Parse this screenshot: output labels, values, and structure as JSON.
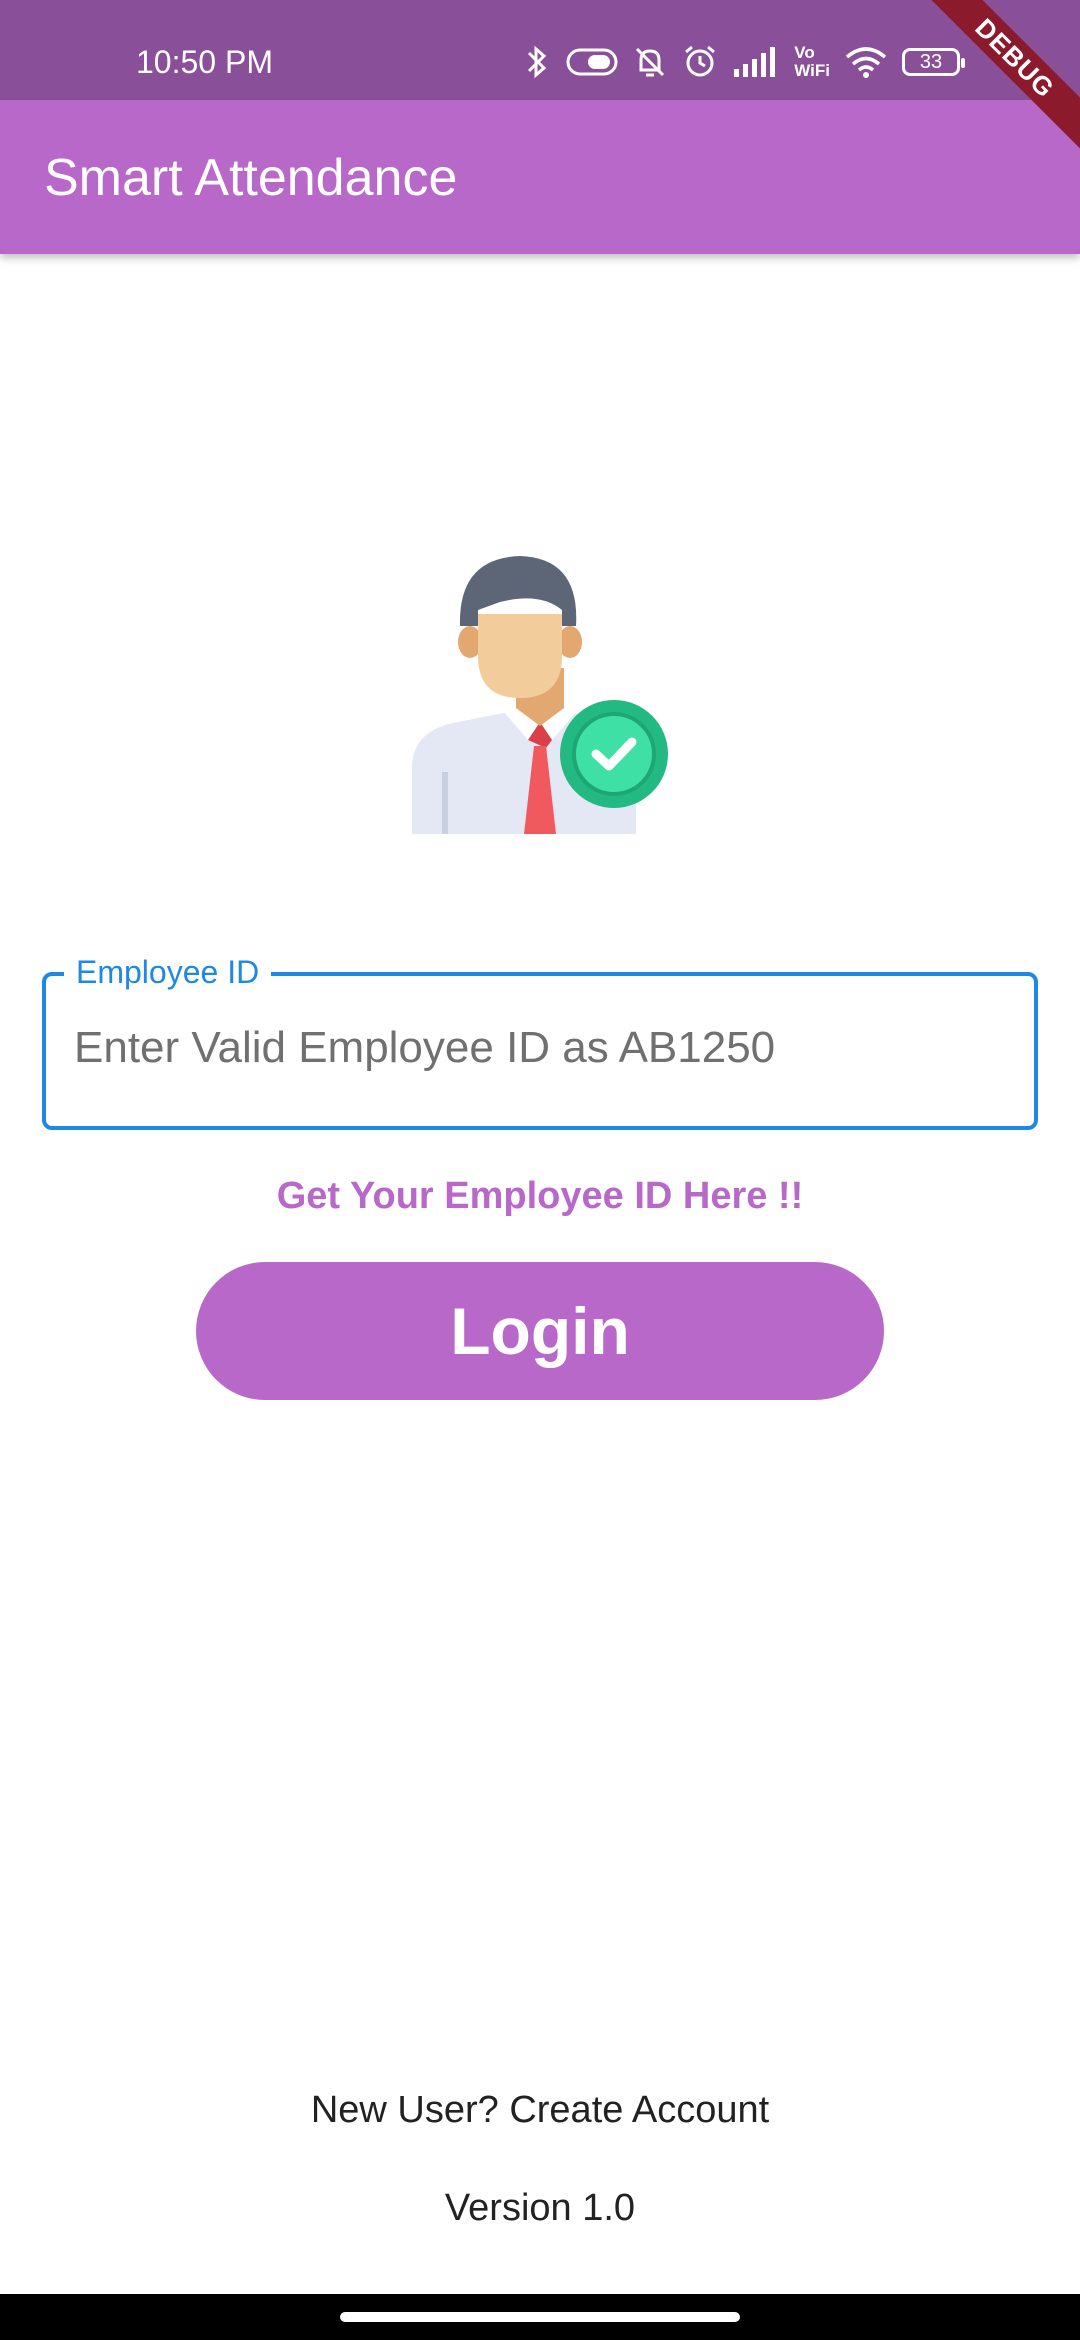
{
  "status_bar": {
    "time": "10:50 PM",
    "vowifi_top": "Vo",
    "vowifi_bottom": "WiFi",
    "battery": "33",
    "icons": [
      "bluetooth-icon",
      "data-saver-icon",
      "mute-bell-icon",
      "alarm-icon",
      "signal-icon",
      "vowifi-icon",
      "wifi-icon",
      "battery-icon"
    ]
  },
  "debug_banner": "DEBUG",
  "app_bar": {
    "title": "Smart Attendance",
    "color": "#b768c9"
  },
  "illustration": {
    "icon": "employee-verified-icon"
  },
  "employee_field": {
    "label": "Employee ID",
    "placeholder": "Enter Valid Employee ID as AB1250",
    "value": "",
    "border_color": "#1e88e5"
  },
  "get_id_link": "Get Your Employee ID Here !!",
  "login_button": "Login",
  "create_account": "New User? Create Account",
  "version": "Version 1.0"
}
